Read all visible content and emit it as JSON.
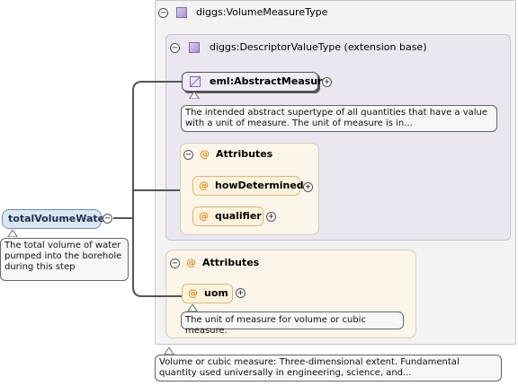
{
  "root": {
    "name": "totalVolumeWater",
    "doc": "The total volume of water pumped into the borehole during this step"
  },
  "type": {
    "name": "diggs:VolumeMeasureType",
    "doc": "Volume or cubic measure: Three-dimensional extent. Fundamental quantity used universally in engineering, science, and..."
  },
  "base": {
    "name": "diggs:DescriptorValueType (extension base)"
  },
  "abstract_measure": {
    "name": "eml:AbstractMeasure",
    "doc": "The intended abstract supertype of all quantities that have a value with a unit of measure. The unit of measure is in..."
  },
  "inner_attributes": {
    "title": "Attributes",
    "items": [
      "howDetermined",
      "qualifier"
    ]
  },
  "outer_attributes": {
    "title": "Attributes",
    "items": [
      "uom"
    ],
    "uom_doc": "The unit of measure for volume or cubic measure."
  },
  "symbols": {
    "at": "@",
    "minus": "−",
    "plus": "+"
  }
}
